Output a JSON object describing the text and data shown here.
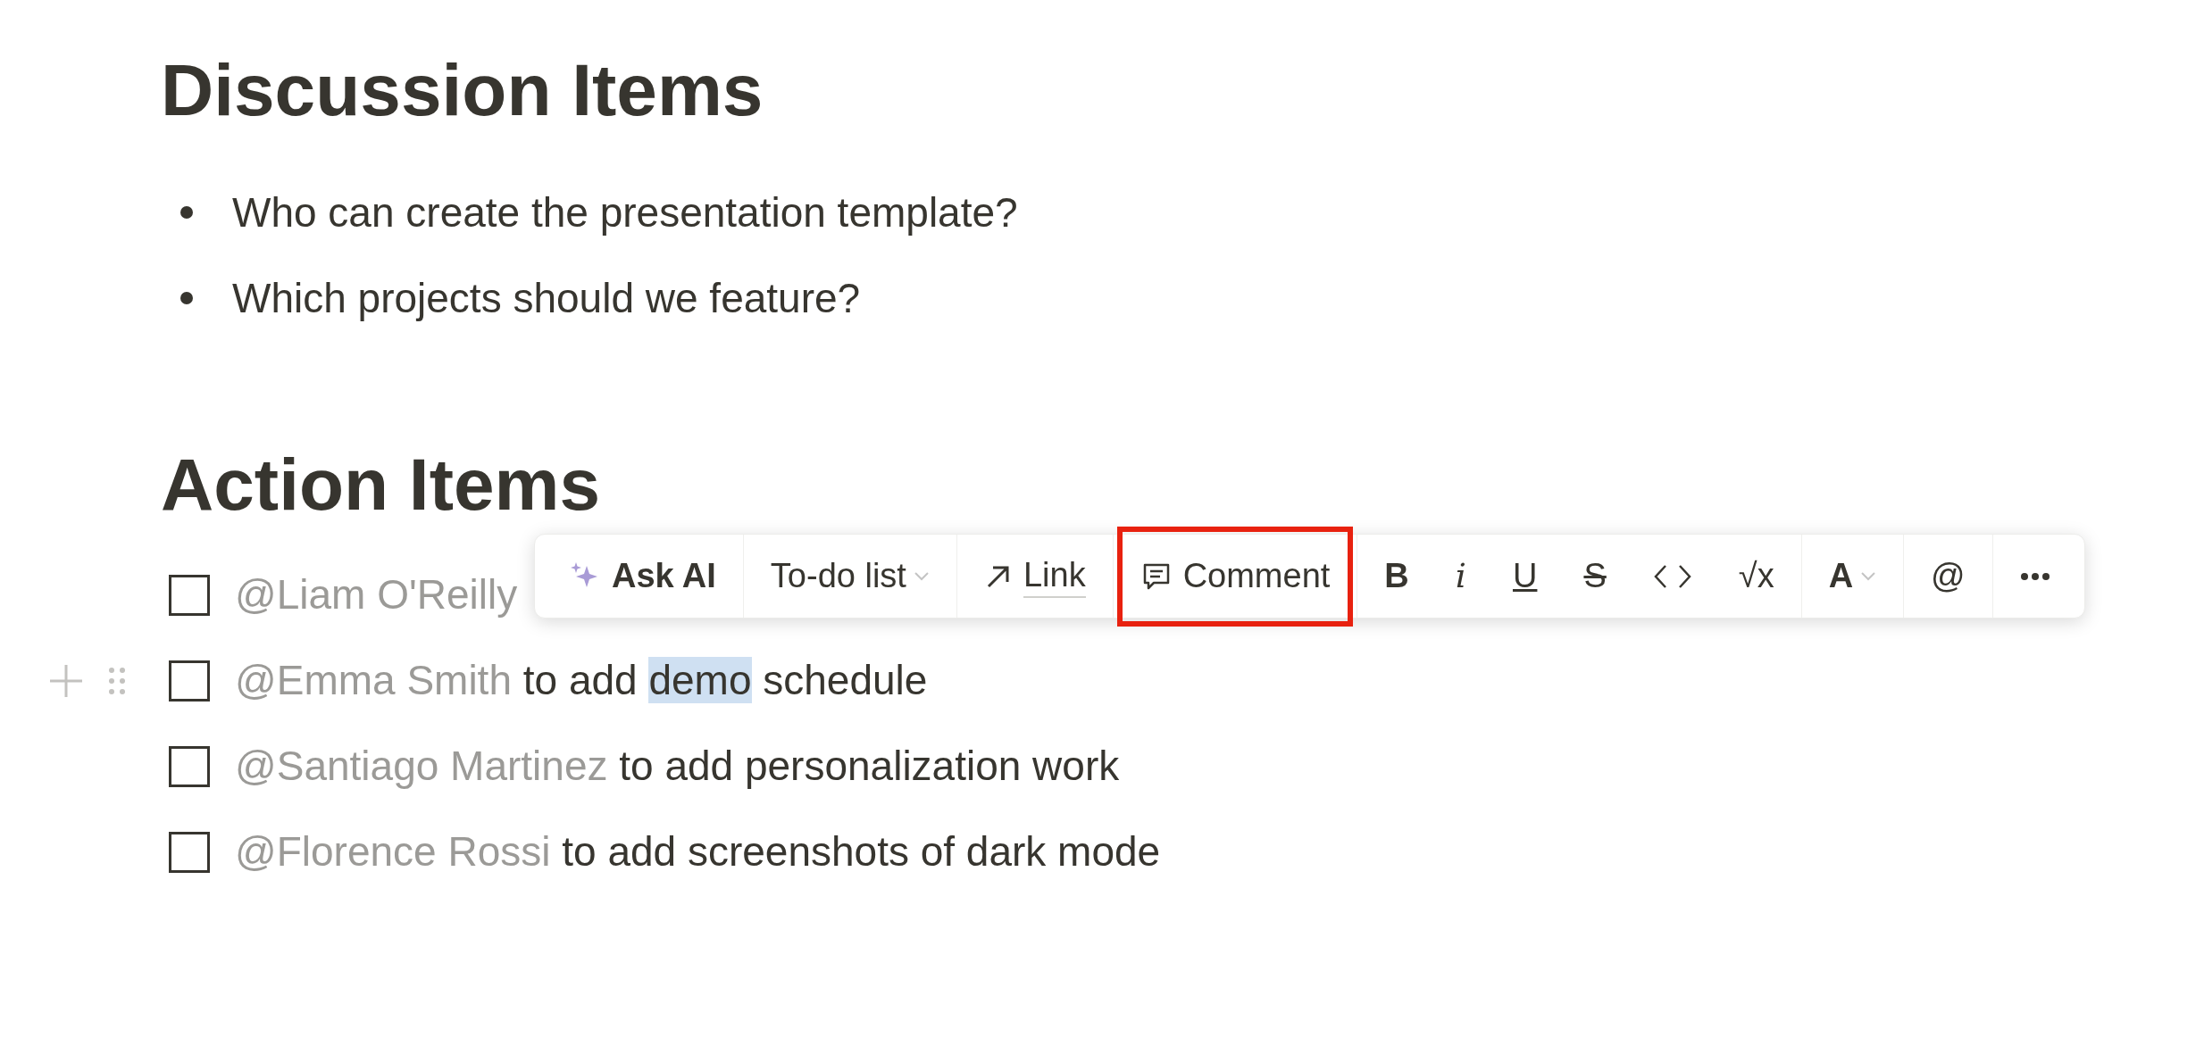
{
  "discussion": {
    "heading": "Discussion Items",
    "bullets": [
      "Who can create the presentation template?",
      "Which projects should we feature?"
    ]
  },
  "actions": {
    "heading": "Action Items",
    "rows": [
      {
        "checked": false,
        "hovered": false,
        "mention": "@Liam O'Reilly",
        "parts": []
      },
      {
        "checked": false,
        "hovered": true,
        "mention": "@Emma Smith",
        "parts": [
          {
            "text": " to add ",
            "selected": false
          },
          {
            "text": "demo",
            "selected": true
          },
          {
            "text": " schedule",
            "selected": false
          }
        ]
      },
      {
        "checked": false,
        "hovered": false,
        "mention": "@Santiago Martinez",
        "parts": [
          {
            "text": " to add personalization work",
            "selected": false
          }
        ]
      },
      {
        "checked": false,
        "hovered": false,
        "mention": "@Florence Rossi",
        "parts": [
          {
            "text": " to add screenshots of dark mode",
            "selected": false
          }
        ]
      }
    ]
  },
  "toolbar": {
    "groups": [
      [
        {
          "kind": "ai",
          "label": "Ask AI",
          "highlighted": false
        }
      ],
      [
        {
          "kind": "dropdown",
          "label": "To-do list",
          "highlighted": false
        }
      ],
      [
        {
          "kind": "link",
          "label": "Link",
          "highlighted": false
        }
      ],
      [
        {
          "kind": "comment",
          "label": "Comment",
          "highlighted": true
        }
      ],
      [
        {
          "kind": "bold",
          "label": "B",
          "highlighted": false
        },
        {
          "kind": "italic",
          "label": "i",
          "highlighted": false
        },
        {
          "kind": "underline",
          "label": "U",
          "highlighted": false
        },
        {
          "kind": "strike",
          "label": "S",
          "highlighted": false
        },
        {
          "kind": "code",
          "highlighted": false
        },
        {
          "kind": "equation",
          "label": "√x",
          "highlighted": false
        }
      ],
      [
        {
          "kind": "color",
          "label": "A",
          "highlighted": false
        }
      ],
      [
        {
          "kind": "mention",
          "label": "@",
          "highlighted": false
        }
      ],
      [
        {
          "kind": "more",
          "highlighted": false
        }
      ]
    ]
  }
}
